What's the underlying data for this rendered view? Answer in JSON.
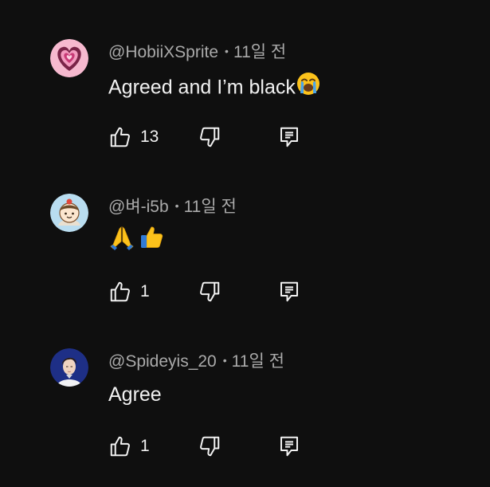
{
  "comments": [
    {
      "handle": "@HobiiXSprite",
      "separator": "•",
      "time": "11일 전",
      "text": "Agreed and I’m black",
      "emojis": [
        "loudly-crying-face"
      ],
      "likes": "13",
      "avatar": "pink-heart-avatar"
    },
    {
      "handle": "@벼-i5b",
      "separator": "•",
      "time": "11일 전",
      "text": "",
      "emojis": [
        "folded-hands",
        "thumbs-up"
      ],
      "likes": "1",
      "avatar": "cartoon-character-avatar"
    },
    {
      "handle": "@Spideyis_20",
      "separator": "•",
      "time": "11일 전",
      "text": "Agree",
      "emojis": [],
      "likes": "1",
      "avatar": "person-photo-avatar"
    }
  ],
  "colors": {
    "background": "#0f0f0f",
    "primary_text": "#f1f1f1",
    "secondary_text": "#aaaaaa",
    "icon": "#f1f1f1"
  }
}
